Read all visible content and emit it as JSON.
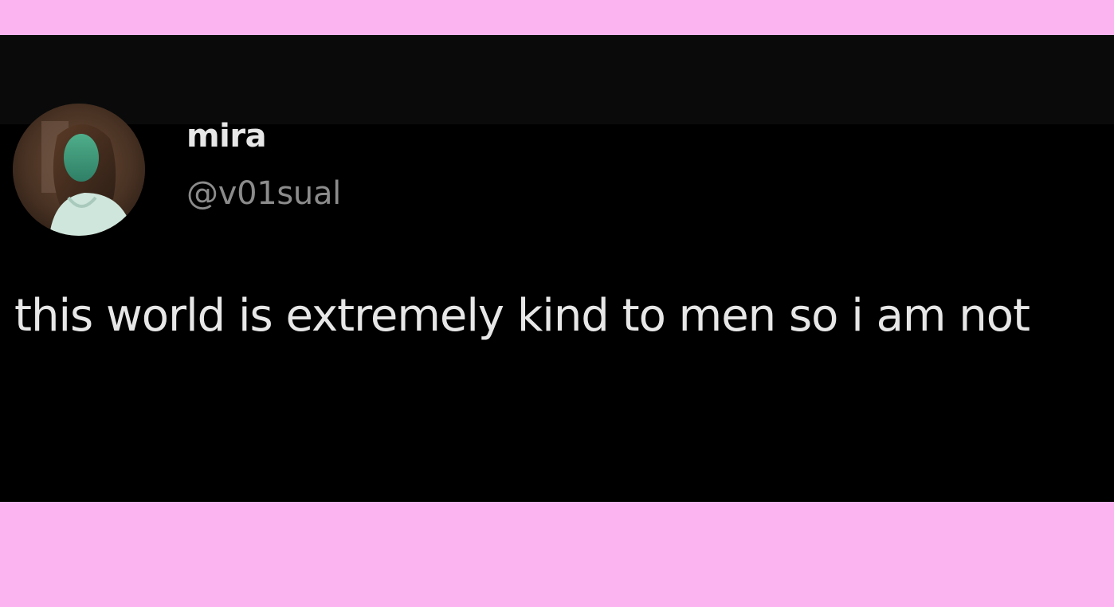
{
  "post": {
    "author": {
      "display_name": "mira",
      "handle": "@v01sual",
      "avatar_icon": "avatar-photo-icon"
    },
    "text": "this world is extremely kind to men so i am not"
  },
  "colors": {
    "frame_background": "#fbb4ef",
    "card_background": "#000000",
    "primary_text": "#e7e7e7",
    "secondary_text": "#8b8b8b"
  }
}
